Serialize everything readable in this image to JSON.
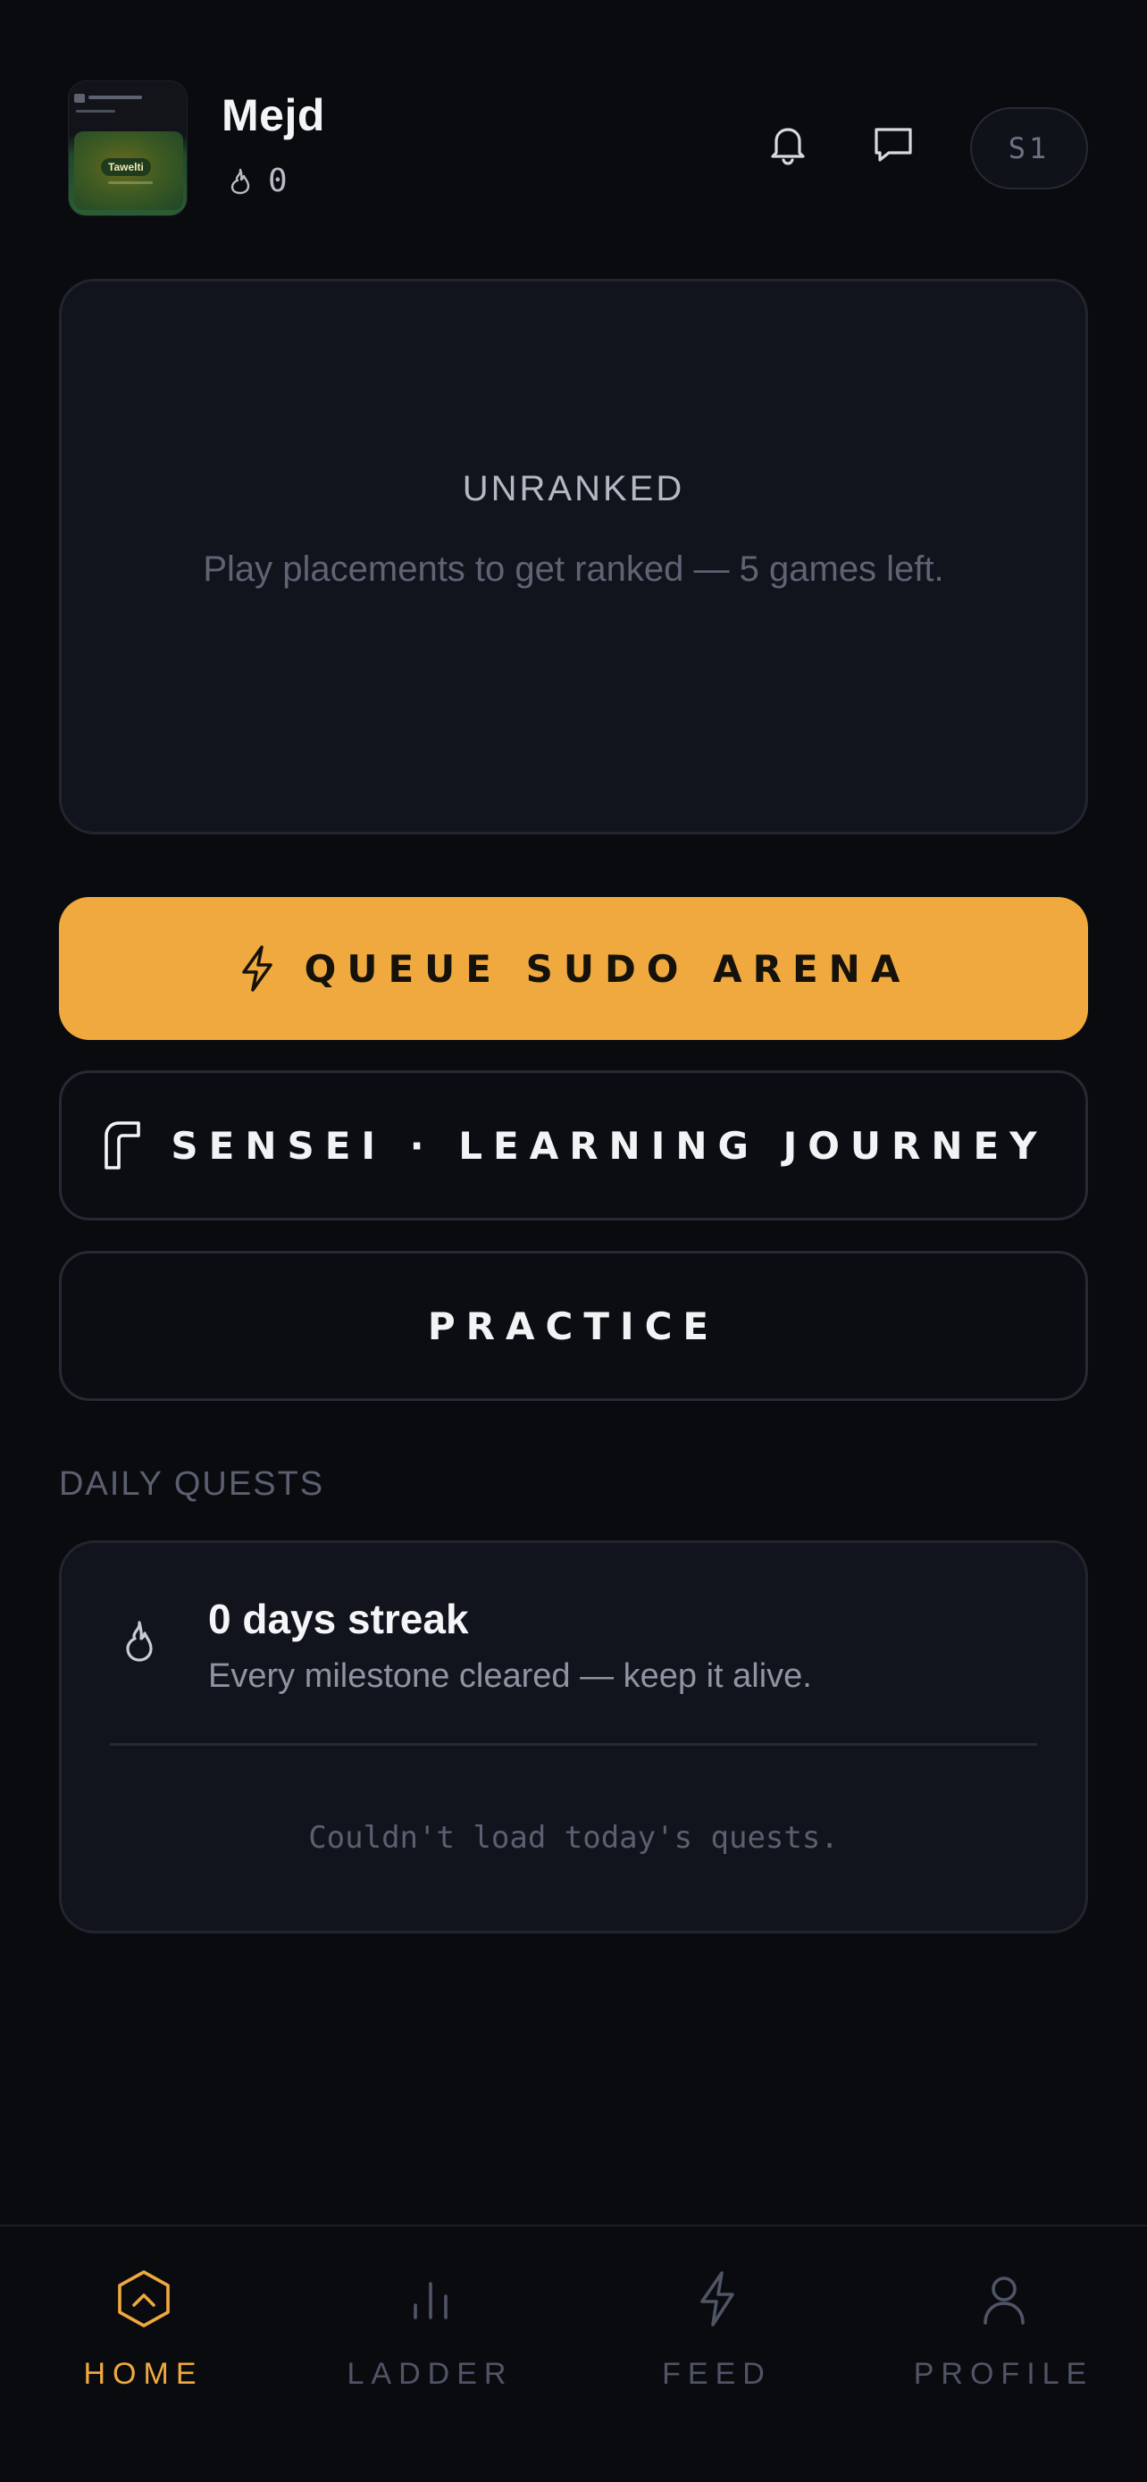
{
  "header": {
    "username": "Mejd",
    "streak_count": "0",
    "season_label": "S1",
    "avatar_brand_text": "Tawelti"
  },
  "rank_card": {
    "title": "UNRANKED",
    "subtitle": "Play placements to get ranked — 5 games left."
  },
  "actions": {
    "queue_label": "QUEUE SUDO ARENA",
    "sensei_label": "SENSEI · LEARNING JOURNEY",
    "practice_label": "PRACTICE"
  },
  "daily_quests": {
    "section_label": "DAILY QUESTS",
    "streak_title": "0 days streak",
    "streak_subtitle": "Every milestone cleared — keep it alive.",
    "error_text": "Couldn't load today's quests."
  },
  "bottom_nav": {
    "items": [
      {
        "label": "HOME",
        "icon": "home-hexagon-icon",
        "active": true
      },
      {
        "label": "LADDER",
        "icon": "ladder-bars-icon",
        "active": false
      },
      {
        "label": "FEED",
        "icon": "bolt-icon",
        "active": false
      },
      {
        "label": "PROFILE",
        "icon": "user-icon",
        "active": false
      }
    ]
  },
  "colors": {
    "background": "#0a0b0f",
    "card": "#12141d",
    "accent": "#f0a93e",
    "muted_text": "#5f6475"
  }
}
